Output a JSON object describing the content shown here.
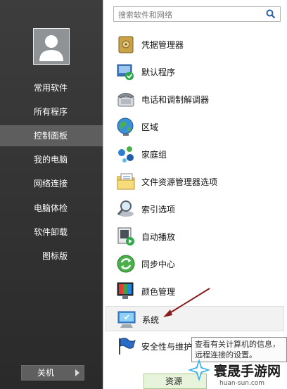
{
  "sidebar": {
    "items": [
      {
        "label": "常用软件"
      },
      {
        "label": "所有程序"
      },
      {
        "label": "控制面板",
        "selected": true
      },
      {
        "label": "我的电脑"
      },
      {
        "label": "网络连接"
      },
      {
        "label": "电脑体检"
      },
      {
        "label": "软件卸载"
      },
      {
        "label": "图标版"
      }
    ],
    "power_label": "关机"
  },
  "search": {
    "placeholder": "搜索软件和网络"
  },
  "items": [
    {
      "label": "凭据管理器",
      "icon": "safe-icon"
    },
    {
      "label": "默认程序",
      "icon": "default-programs-icon"
    },
    {
      "label": "电话和调制解调器",
      "icon": "phone-icon"
    },
    {
      "label": "区域",
      "icon": "globe-icon"
    },
    {
      "label": "家庭组",
      "icon": "homegroup-icon"
    },
    {
      "label": "文件资源管理器选项",
      "icon": "folder-options-icon"
    },
    {
      "label": "索引选项",
      "icon": "magnifier-icon"
    },
    {
      "label": "自动播放",
      "icon": "autoplay-icon"
    },
    {
      "label": "同步中心",
      "icon": "sync-icon"
    },
    {
      "label": "颜色管理",
      "icon": "color-icon"
    },
    {
      "label": "系统",
      "icon": "monitor-icon",
      "highlighted": true
    },
    {
      "label": "安全性与维护",
      "icon": "flag-icon"
    }
  ],
  "tooltip": {
    "line1": "查看有关计算机的信息，",
    "line2": "远程连接的设置。"
  },
  "bottom_button": {
    "label": "资源"
  },
  "watermark": {
    "title": "寰晟手游网",
    "url": "huan-sun.com"
  },
  "colors": {
    "sidebar_bg": "#333333",
    "selected_bg": "#5e5e5e",
    "tooltip_border": "#8a8a8a",
    "arrow": "#8b1a1a"
  }
}
